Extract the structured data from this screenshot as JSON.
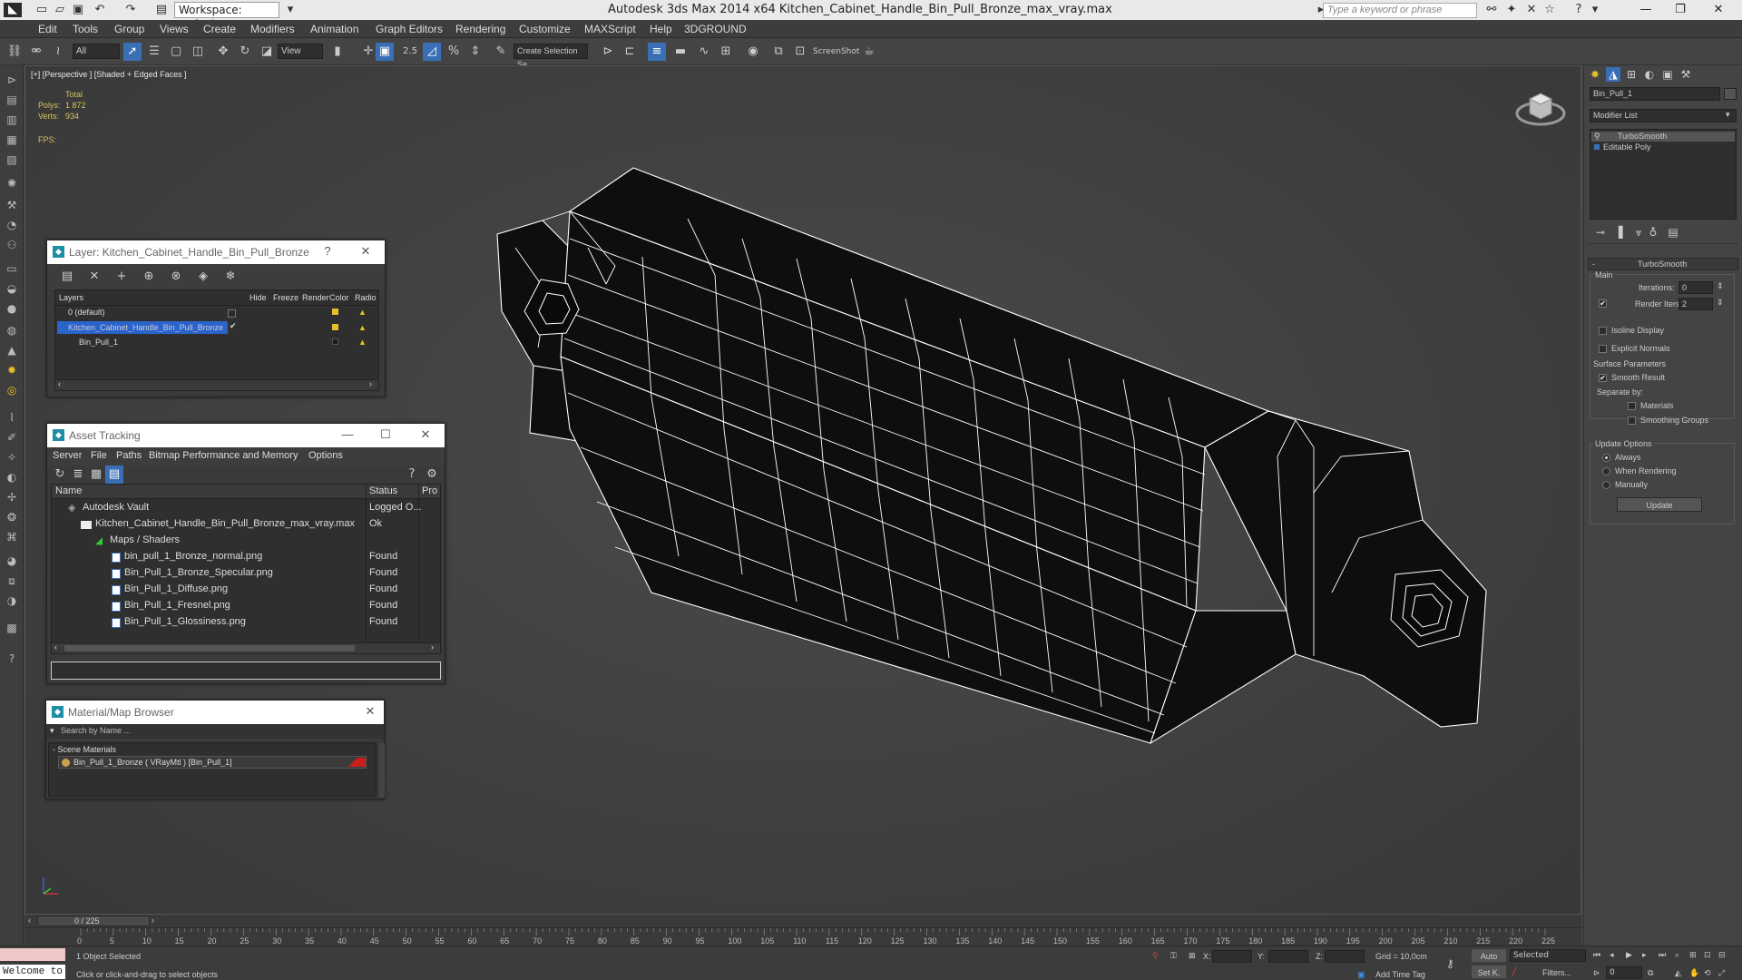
{
  "app": {
    "title": "Autodesk 3ds Max  2014 x64     Kitchen_Cabinet_Handle_Bin_Pull_Bronze_max_vray.max",
    "workspace": "Workspace: Default",
    "search_placeholder": "Type a keyword or phrase"
  },
  "menu": [
    "Edit",
    "Tools",
    "Group",
    "Views",
    "Create",
    "Modifiers",
    "Animation",
    "Graph Editors",
    "Rendering",
    "Customize",
    "MAXScript",
    "Help",
    "3DGROUND"
  ],
  "toolbar": {
    "filter": "All",
    "ref_coord": "View",
    "named_selection": "Create Selection Se",
    "screenshot_label": "ScreenShot",
    "snap_label": "2.5"
  },
  "viewport": {
    "label": "[+] [Perspective ] [Shaded + Edged Faces ]",
    "stats_header": "Total",
    "polys_label": "Polys:",
    "polys": "1 872",
    "verts_label": "Verts:",
    "verts": "934",
    "fps_label": "FPS:"
  },
  "layer_window": {
    "title": "Layer: Kitchen_Cabinet_Handle_Bin_Pull_Bronze",
    "help": "?",
    "columns": [
      "Layers",
      "Hide",
      "Freeze",
      "Render",
      "Color",
      "Radio"
    ],
    "rows": [
      {
        "name": "0 (default)"
      },
      {
        "name": "Kitchen_Cabinet_Handle_Bin_Pull_Bronze"
      },
      {
        "name": "Bin_Pull_1"
      }
    ]
  },
  "asset_window": {
    "title": "Asset Tracking",
    "menu": [
      "Server",
      "File",
      "Paths",
      "Bitmap Performance and Memory",
      "Options"
    ],
    "columns": [
      "Name",
      "Status",
      "Pro"
    ],
    "rows": [
      {
        "name": "Autodesk Vault",
        "status": "Logged O..."
      },
      {
        "name": "Kitchen_Cabinet_Handle_Bin_Pull_Bronze_max_vray.max",
        "status": "Ok"
      },
      {
        "name": "Maps / Shaders",
        "status": ""
      },
      {
        "name": "bin_pull_1_Bronze_normal.png",
        "status": "Found"
      },
      {
        "name": "Bin_Pull_1_Bronze_Specular.png",
        "status": "Found"
      },
      {
        "name": "Bin_Pull_1_Diffuse.png",
        "status": "Found"
      },
      {
        "name": "Bin_Pull_1_Fresnel.png",
        "status": "Found"
      },
      {
        "name": "Bin_Pull_1_Glossiness.png",
        "status": "Found"
      }
    ]
  },
  "material_window": {
    "title": "Material/Map Browser",
    "search": "Search by Name ...",
    "section": "- Scene Materials",
    "item": "Bin_Pull_1_Bronze  ( VRayMtl )  [Bin_Pull_1]"
  },
  "command_panel": {
    "object_name": "Bin_Pull_1",
    "modifier_list": "Modifier List",
    "stack": [
      "TurboSmooth",
      "Editable Poly"
    ],
    "rollout_title": "TurboSmooth",
    "main_label": "Main",
    "iterations_label": "Iterations:",
    "iterations": "0",
    "render_iters_label": "Render Iters:",
    "render_iters": "2",
    "isoline": "Isoline Display",
    "explicit_normals": "Explicit Normals",
    "surface_params": "Surface Parameters",
    "smooth_result": "Smooth Result",
    "separate_by": "Separate by:",
    "materials": "Materials",
    "smoothing_groups": "Smoothing Groups",
    "update_options": "Update Options",
    "always": "Always",
    "when_rendering": "When Rendering",
    "manually": "Manually",
    "update_btn": "Update"
  },
  "timeline": {
    "frame": "0 / 225",
    "ticks": [
      "0",
      "5",
      "10",
      "15",
      "20",
      "25",
      "30",
      "35",
      "40",
      "45",
      "50",
      "55",
      "60",
      "65",
      "70",
      "75",
      "80",
      "85",
      "90",
      "95",
      "100",
      "105",
      "110",
      "115",
      "120",
      "125",
      "130",
      "135",
      "140",
      "145",
      "150",
      "155",
      "160",
      "165",
      "170",
      "175",
      "180",
      "185",
      "190",
      "195",
      "200",
      "205",
      "210",
      "215",
      "220",
      "225"
    ]
  },
  "status": {
    "welcome": "Welcome to",
    "selected": "1 Object Selected",
    "prompt": "Click or click-and-drag to select objects",
    "x_label": "X:",
    "y_label": "Y:",
    "z_label": "Z:",
    "grid": "Grid = 10,0cm",
    "add_time_tag": "Add Time Tag",
    "auto": "Auto",
    "set_key": "Set K.",
    "key_mode": "Selected",
    "filters": "Filters...",
    "frame_field": "0"
  },
  "colors": {
    "accent": "#3a6fb5",
    "selection": "#2a63c9",
    "stat": "#d4c35a",
    "material": "#c81e1e"
  }
}
